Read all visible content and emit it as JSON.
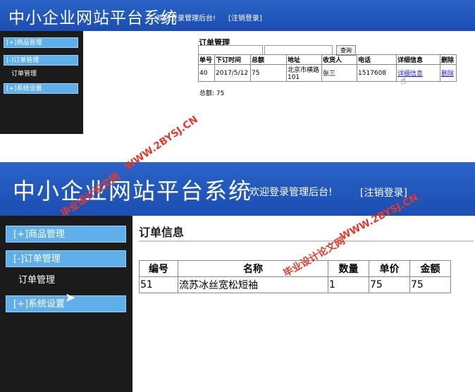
{
  "panel1": {
    "header": {
      "title": "中小企业网站平台系统",
      "welcome": "欢迎登录管理后台!",
      "logout": "[注销登录]"
    },
    "sidebar": {
      "menus": [
        "[+]商品管理",
        "[-]订单管理",
        "[+]系统设置"
      ],
      "submenu": "订单管理"
    },
    "main": {
      "title": "订单管理",
      "search_button": "查询",
      "columns": [
        "单号",
        "下订时间",
        "总额",
        "地址",
        "收货人",
        "电话",
        "详细信息",
        "删除"
      ],
      "row": {
        "id": "40",
        "date": "2017/5/12",
        "total": "75",
        "address": "北京市横路101",
        "receiver": "张三",
        "phone": "1517608",
        "detail_link": "详细信息",
        "delete_link": "删除"
      },
      "total_text": "总额: 75"
    }
  },
  "panel2": {
    "header": {
      "title": "中小企业网站平台系统",
      "welcome": "欢迎登录管理后台!",
      "logout": "[注销登录]"
    },
    "sidebar": {
      "menus": [
        "[+]商品管理",
        "[-]订单管理",
        "[+]系统设置"
      ],
      "submenu": "订单管理"
    },
    "main": {
      "title": "订单信息",
      "columns": [
        "编号",
        "名称",
        "数量",
        "单价",
        "金额"
      ],
      "row": {
        "id": "51",
        "name": "流苏冰丝宽松短袖",
        "qty": "1",
        "price": "75",
        "amount": "75"
      }
    }
  },
  "watermarks": {
    "url": "WWW.2BYSJ.CN",
    "site": "毕业设计论文网"
  }
}
